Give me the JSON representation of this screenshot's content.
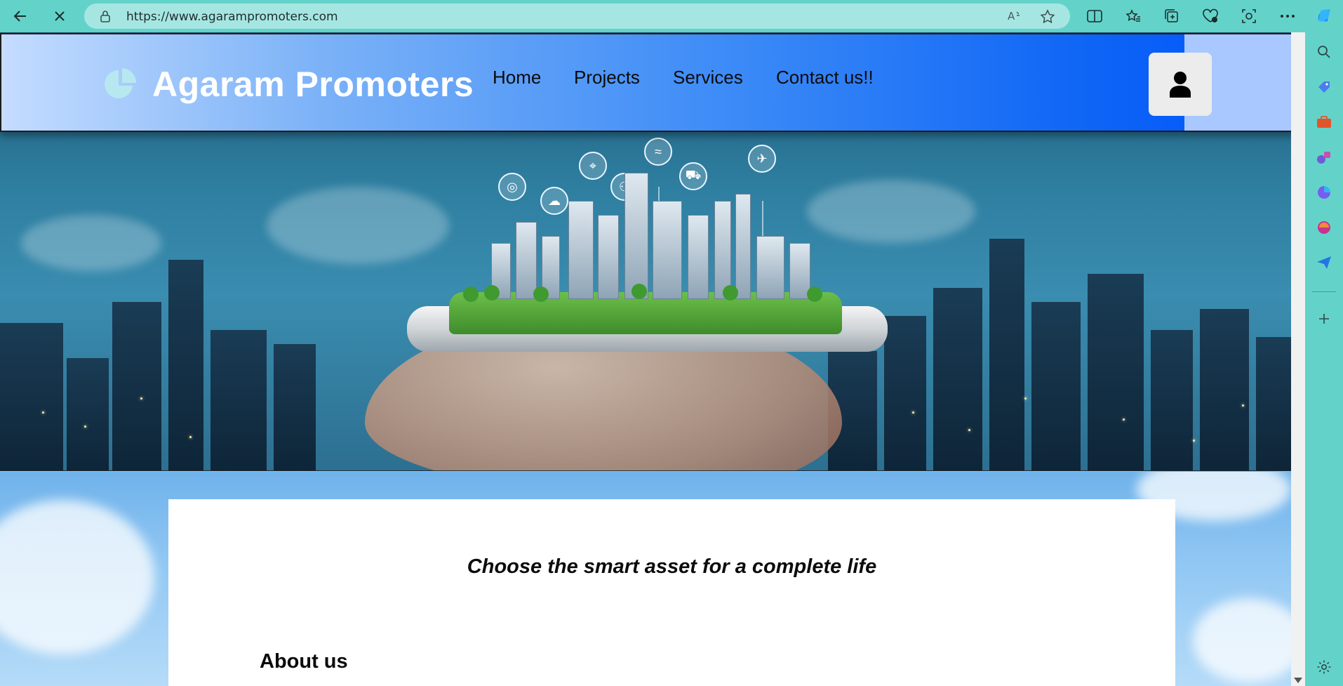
{
  "browser": {
    "url": "https://www.agarampromoters.com",
    "back_icon": "back-arrow-icon",
    "stop_icon": "close-icon"
  },
  "site": {
    "brand": "Agaram Promoters",
    "nav": [
      {
        "label": "Home"
      },
      {
        "label": "Projects"
      },
      {
        "label": "Services"
      },
      {
        "label": "Contact us!!"
      }
    ],
    "tagline": "Choose the smart asset for a complete life",
    "about_title": "About us",
    "colors": {
      "header_gradient_start": "#c4dcff",
      "header_gradient_end": "#0053ff",
      "brand_text": "#ffffff",
      "browser_chrome": "#63d3ca"
    }
  }
}
